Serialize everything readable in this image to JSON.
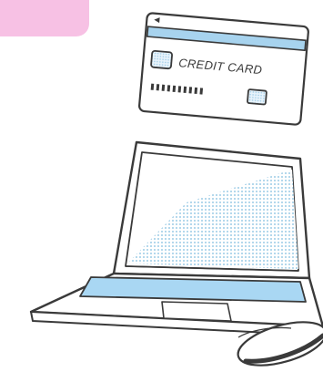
{
  "illustration": {
    "card_text": "CREDIT CARD",
    "icons": [
      "credit-card-icon",
      "laptop-icon",
      "mouse-icon"
    ]
  },
  "colors": {
    "tab_pink": "#f7c1e4",
    "card_stripe_blue": "#a7d3ee",
    "screen_blue": "#bfe2f6",
    "touchpad_blue": "#a9d7f3",
    "outline": "#3a3a3a"
  }
}
